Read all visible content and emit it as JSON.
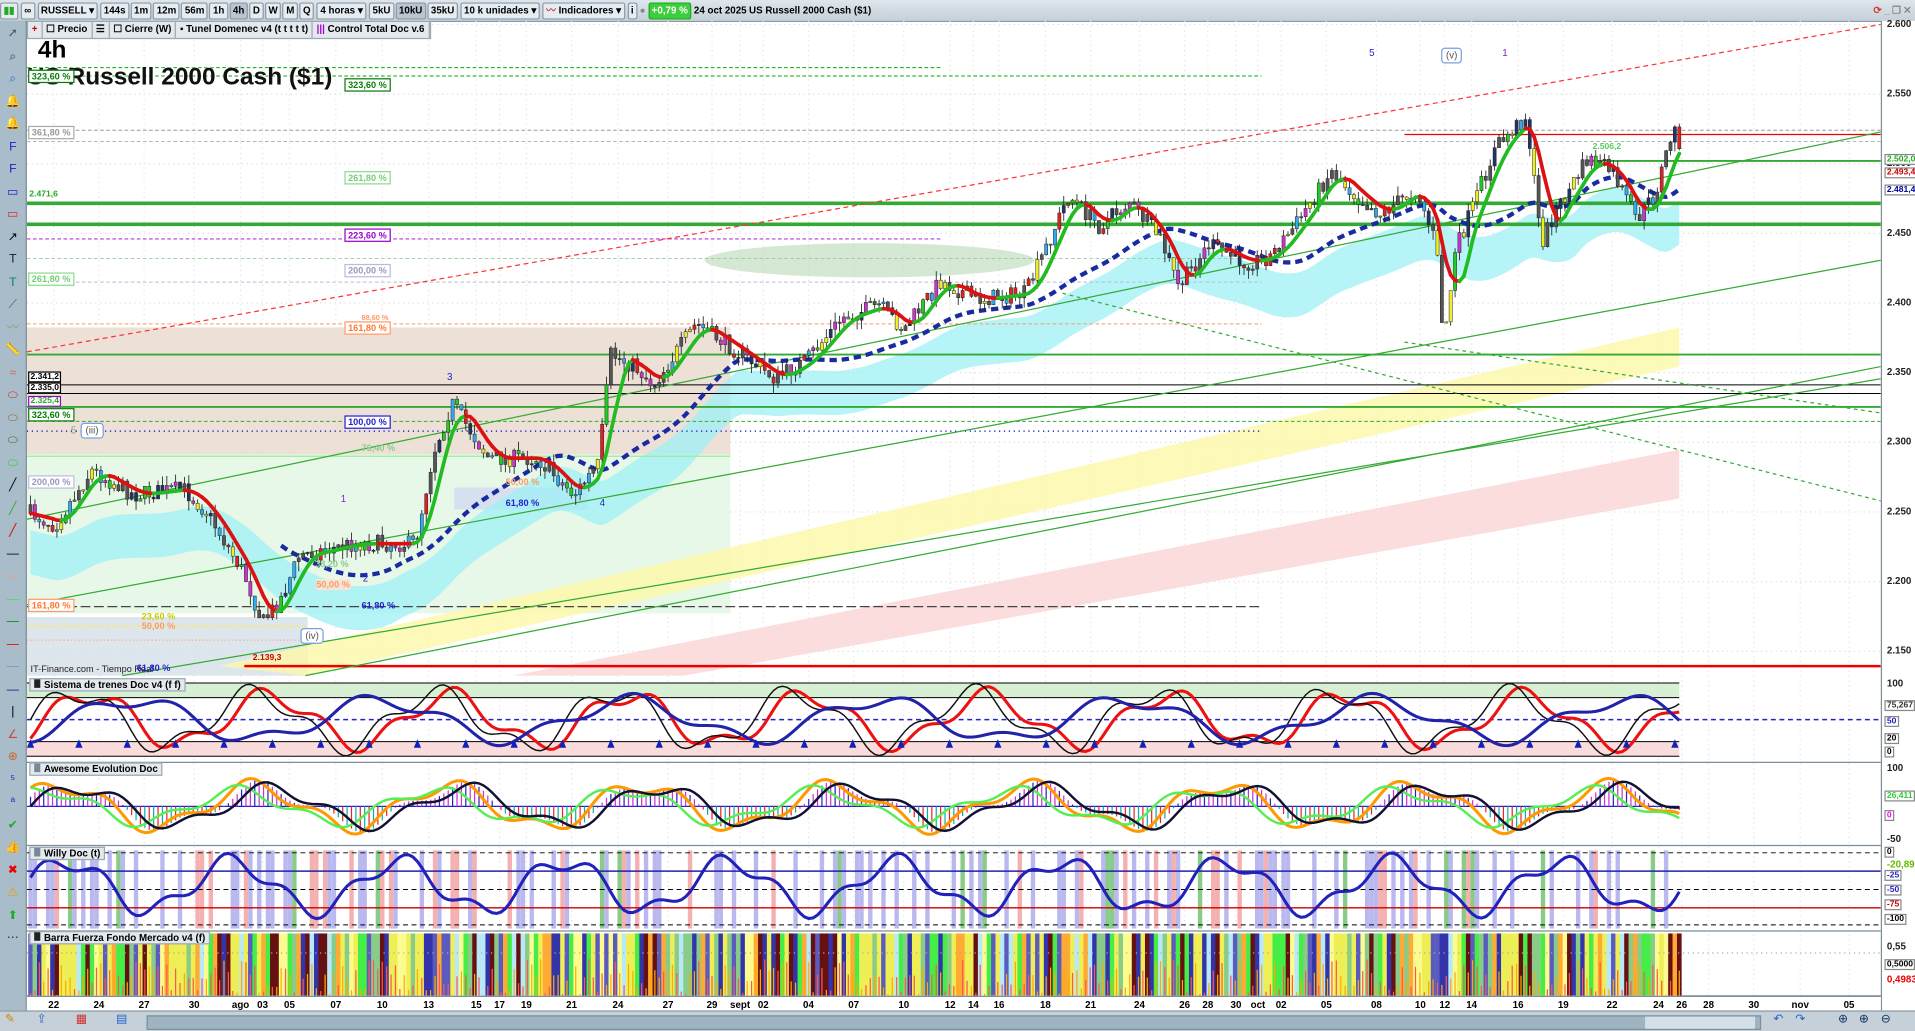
{
  "toolbar": {
    "symbol": "RUSSELL",
    "timeframes": [
      "144s",
      "1m",
      "12m",
      "56m",
      "1h",
      "4h",
      "D",
      "W",
      "M",
      "Q"
    ],
    "active_timeframe": "4h",
    "period_select": "4 horas",
    "units": [
      "5kU",
      "10kU",
      "35kU"
    ],
    "active_unit": "10kU",
    "units_select": "10 k unidades",
    "indicators_label": "Indicadores",
    "change_pct": "+0,79 %",
    "date": "24 oct 2025",
    "instrument": "US Russell 2000 Cash ($1)"
  },
  "legend": {
    "items": [
      "Precio",
      "Cierre (W)",
      "Tunel Domenec v4 (t t t t t)",
      "Control Total Doc v.6"
    ]
  },
  "chart": {
    "timeframe_title": "4h",
    "title": "US Russell 2000 Cash ($1)",
    "watermark": "IT-Finance.com - Tiempo Real",
    "price_ticks": [
      "2.600",
      "2.550",
      "2.500",
      "2.450",
      "2.400",
      "2.350",
      "2.300",
      "2.250",
      "2.200",
      "2.150"
    ],
    "last_prices": [
      {
        "value": "2.502,0",
        "color": "#22aa22"
      },
      {
        "value": "2.493,4",
        "color": "#cc0000"
      },
      {
        "value": "2.481,4",
        "color": "#000099"
      }
    ],
    "level_tags": {
      "l1": "2.471,6",
      "l2": "2.341,2",
      "l3": "2.335,0",
      "l4": "2.325,4",
      "low": "2.139,3",
      "high": "2.506,2"
    },
    "fib_labels": {
      "f1": "323,60 %",
      "f2": "323,60 %",
      "f3": "361,80 %",
      "f4": "261,80 %",
      "f5": "261,80 %",
      "f6": "223,60 %",
      "f7": "200,00 %",
      "f8": "161,80 %",
      "f9": "200,00 %",
      "f10": "161,80 %",
      "f11": "100,00 %",
      "f12": "76,40 %",
      "f13": "50,00 %",
      "f14": "61,80 %",
      "f15": "50,00 %",
      "f16": "61,80 %",
      "f17": "23,60 %",
      "f18": "50,00 %",
      "f19": "61,80 %",
      "f20": "38,20 %",
      "f21": "323,60 %",
      "f22": "88,60 %"
    },
    "waves": {
      "w5a": "5",
      "w3": "3",
      "w1a": "1",
      "w2": "2",
      "w4": "4",
      "w5b": "5",
      "w1b": "1"
    },
    "wave_boxes": {
      "iii": "(iii)",
      "iv": "(iv)",
      "v": "(v)"
    }
  },
  "panels": [
    {
      "title": "Sistema de trenes Doc v4 (f f)",
      "ticks": [
        "100",
        "75,267",
        "50",
        "20",
        "0"
      ]
    },
    {
      "title": "Awesome Evolution Doc",
      "ticks": [
        "100",
        "26,411",
        "0",
        "-50"
      ]
    },
    {
      "title": "Willy Doc (t)",
      "ticks": [
        "0",
        "-20,890",
        "-25",
        "-50",
        "-75",
        "-100"
      ]
    },
    {
      "title": "Barra Fuerza Fondo Mercado v4 (f)",
      "ticks": [
        "0,55",
        "0,5000",
        "0,4983"
      ]
    }
  ],
  "date_axis": [
    "22",
    "24",
    "27",
    "30",
    "ago",
    "03",
    "05",
    "07",
    "10",
    "13",
    "15",
    "17",
    "19",
    "21",
    "24",
    "27",
    "29",
    "sept",
    "02",
    "04",
    "07",
    "10",
    "12",
    "14",
    "16",
    "18",
    "21",
    "24",
    "26",
    "28",
    "30",
    "oct",
    "02",
    "05",
    "08",
    "10",
    "12",
    "14",
    "16",
    "19",
    "22",
    "24",
    "26",
    "28",
    "30",
    "nov",
    "05"
  ],
  "colors": {
    "bull": "#22bb22",
    "bear": "#dd1111",
    "ma_slow": "#1a2aa0",
    "band": "#9ff0f5",
    "pct_badge": "#3ccf3c"
  }
}
